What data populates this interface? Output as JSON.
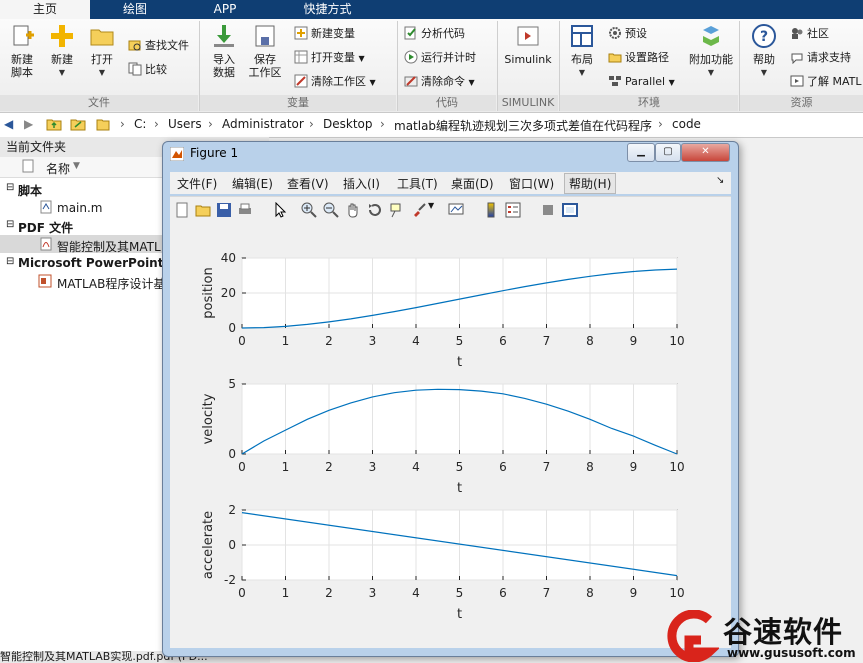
{
  "ribbon_tabs": [
    "主页",
    "绘图",
    "APP",
    "快捷方式"
  ],
  "ribbon": {
    "new_script": "新建\n脚本",
    "new": "新建",
    "open": "打开",
    "find_files": "查找文件",
    "compare": "比较",
    "import_data": "导入\n数据",
    "save_workspace": "保存\n工作区",
    "new_variable": "新建变量",
    "open_variable": "打开变量",
    "clear_workspace": "清除工作区",
    "analyze_code": "分析代码",
    "run_and_time": "运行并计时",
    "clear_commands": "清除命令",
    "simulink": "Simulink",
    "layout": "布局",
    "preferences": "预设",
    "set_path": "设置路径",
    "parallel": "Parallel",
    "addons": "附加功能",
    "help": "帮助",
    "community": "社区",
    "request_support": "请求支持",
    "learn_matlab": "了解 MATL",
    "groups": [
      "文件",
      "变量",
      "代码",
      "SIMULINK",
      "环境",
      "资源"
    ]
  },
  "address": {
    "crumbs": [
      "C:",
      "Users",
      "Administrator",
      "Desktop",
      "matlab编程轨迹规划三次多项式差值在代码程序",
      "code"
    ]
  },
  "left_panel": {
    "title": "当前文件夹",
    "column_name": "名称",
    "group_script": "脚本",
    "file_main": "main.m",
    "group_pdf": "PDF 文件",
    "file_pdf": "智能控制及其MATL",
    "group_ppt": "Microsoft PowerPoint 9",
    "file_ppt": "MATLAB程序设计基",
    "status": "智能控制及其MATLAB实现.pdf.pdf  (PD..."
  },
  "figure": {
    "title": "Figure 1",
    "menus": [
      "文件(F)",
      "编辑(E)",
      "查看(V)",
      "插入(I)",
      "工具(T)",
      "桌面(D)",
      "窗口(W)",
      "帮助(H)"
    ]
  },
  "chart_data": [
    {
      "type": "line",
      "ylabel": "position",
      "xlabel": "t",
      "xlim": [
        0,
        10
      ],
      "ylim": [
        0,
        40
      ],
      "xticks": [
        0,
        1,
        2,
        3,
        4,
        5,
        6,
        7,
        8,
        9,
        10
      ],
      "yticks": [
        0,
        20,
        40
      ],
      "grid": true,
      "x": [
        0,
        0.5,
        1,
        1.5,
        2,
        2.5,
        3,
        3.5,
        4,
        4.5,
        5,
        5.5,
        6,
        6.5,
        7,
        7.5,
        8,
        8.5,
        9,
        9.5,
        10
      ],
      "y": [
        0,
        0.24,
        0.93,
        2.03,
        3.47,
        5.21,
        7.2,
        9.37,
        11.68,
        14.08,
        16.5,
        18.92,
        21.31,
        23.63,
        25.79,
        27.79,
        29.57,
        31.09,
        32.31,
        33.17,
        33.67
      ],
      "color": "#0072bd"
    },
    {
      "type": "line",
      "ylabel": "velocity",
      "xlabel": "t",
      "xlim": [
        0,
        10
      ],
      "ylim": [
        0,
        5
      ],
      "xticks": [
        0,
        1,
        2,
        3,
        4,
        5,
        6,
        7,
        8,
        9,
        10
      ],
      "yticks": [
        0,
        5
      ],
      "grid": true,
      "x": [
        0,
        0.5,
        1,
        1.5,
        2,
        2.5,
        3,
        3.5,
        4,
        4.5,
        5,
        5.5,
        6,
        6.5,
        7,
        7.5,
        8,
        8.5,
        9,
        9.5,
        10
      ],
      "y": [
        0,
        0.93,
        1.71,
        2.48,
        3.12,
        3.65,
        4.08,
        4.38,
        4.56,
        4.62,
        4.6,
        4.49,
        4.3,
        3.97,
        3.56,
        3.06,
        2.48,
        1.82,
        1.28,
        0.62,
        0
      ],
      "color": "#0072bd"
    },
    {
      "type": "line",
      "ylabel": "accelerate",
      "xlabel": "t",
      "xlim": [
        0,
        10
      ],
      "ylim": [
        -2,
        2
      ],
      "xticks": [
        0,
        1,
        2,
        3,
        4,
        5,
        6,
        7,
        8,
        9,
        10
      ],
      "yticks": [
        -2,
        0,
        2
      ],
      "grid": true,
      "x": [
        0,
        10
      ],
      "y": [
        1.85,
        -1.75
      ],
      "color": "#0072bd"
    }
  ],
  "watermark": {
    "text": "谷速软件",
    "url": "www.gususoft.com"
  }
}
